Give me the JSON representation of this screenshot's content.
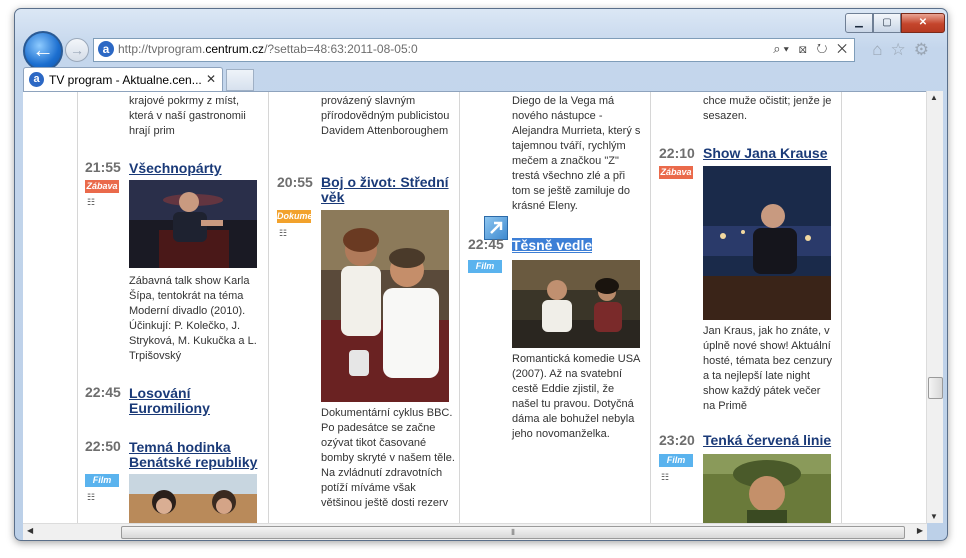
{
  "window": {
    "minimize": "▁",
    "maximize": "▢",
    "close": "✕"
  },
  "addressbar": {
    "url_prefix": "http://tvprogram.",
    "url_host": "centrum.cz",
    "url_path": "/?settab=48:63:2011-08-05:0",
    "tools": "⌕▾ ⊠ ↻ ✕"
  },
  "toolbar": {
    "back": "←",
    "forward": "→",
    "right_icons": "⌂☆⚙"
  },
  "tab": {
    "title": "TV program - Aktualne.cen...",
    "close": "✕",
    "logo": "a"
  },
  "columns": {
    "col1": {
      "top_desc": "krajové pokrmy z míst, která v naší gastronomii hrají prim",
      "p1": {
        "time": "21:55",
        "title": "Všechnopárty",
        "badge": "Zábava",
        "desc": "Zábavná talk show Karla Šípa, tentokrát na téma Moderní divadlo (2010). Účinkují: P. Kolečko, J. Stryková, M. Kukučka a L. Trpišovský"
      },
      "p2": {
        "time": "22:45",
        "title": "Losování Euromiliony"
      },
      "p3": {
        "time": "22:50",
        "title": "Temná hodinka Benátské republiky",
        "badge": "Film"
      }
    },
    "col2": {
      "top_desc": "provázený slavným přírodovědným publicistou Davidem Attenboroughem",
      "p1": {
        "time": "20:55",
        "title": "Boj o život: Střední věk",
        "badge": "Dokume",
        "desc": "Dokumentární cyklus BBC. Po padesátce se začne ozývat tikot časované bomby skryté v našem těle. Na zvládnutí zdravotních potíží míváme však většinou ještě dosti rezerv"
      }
    },
    "col3": {
      "top_desc": "Diego de la Vega má nového nástupce - Alejandra Murrieta, který s tajemnou tváří, rychlým mečem a značkou \"Z\" trestá všechno zlé a při tom se ještě zamiluje do krásné Eleny.",
      "p1": {
        "time": "22:45",
        "title": "Těsně vedle",
        "badge": "Film",
        "desc": "Romantická komedie USA (2007). Až na svatební cestě Eddie zjistil, že našel tu pravou. Dotyčná dáma ale bohužel nebyla jeho novomanželka."
      }
    },
    "col4": {
      "top_desc": "chce muže očistit; jenže je sesazen.",
      "p1": {
        "time": "22:10",
        "title": "Show Jana Krause",
        "badge": "Zábava",
        "desc": "Jan Kraus, jak ho znáte, v úplně nové show! Aktuální hosté, témata bez cenzury a ta nejlepší late night show každý pátek večer na Primě"
      },
      "p2": {
        "time": "23:20",
        "title": "Tenká červená linie",
        "badge": "Film"
      }
    }
  },
  "icons": {
    "list": "☷",
    "scroll_up": "▲",
    "scroll_down": "▼",
    "scroll_left": "◀",
    "scroll_right": "▶",
    "grip": "⦀"
  }
}
